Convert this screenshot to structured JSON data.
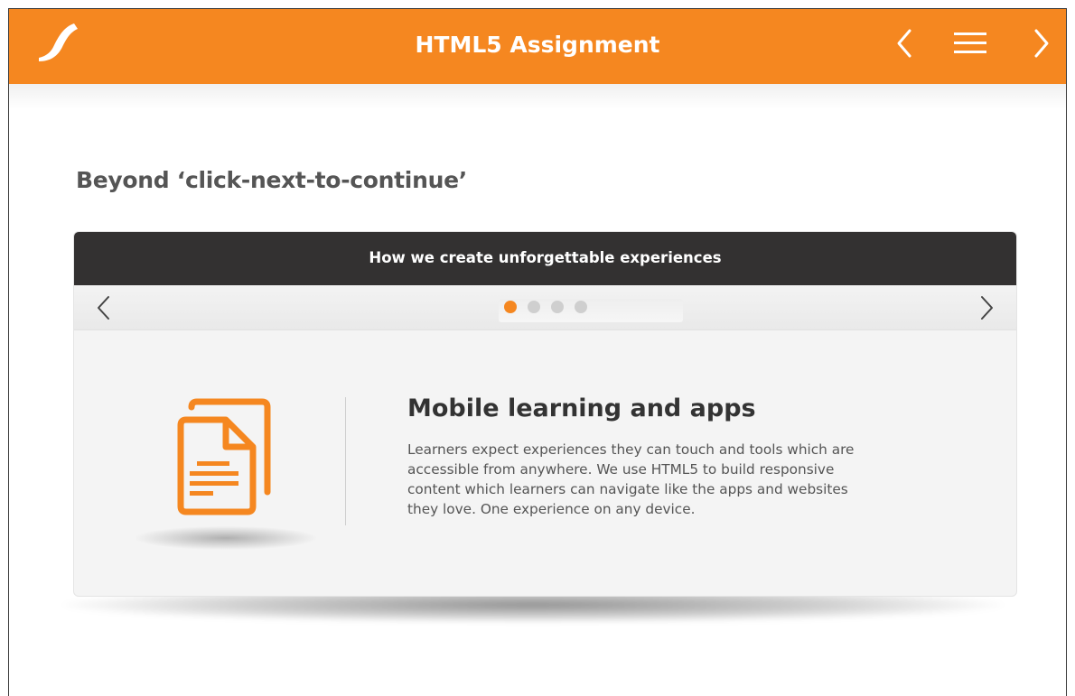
{
  "header": {
    "title": "HTML5 Assignment",
    "logo_icon": "swoosh-logo-icon",
    "prev_icon": "chevron-left-icon",
    "menu_icon": "hamburger-menu-icon",
    "next_icon": "chevron-right-icon",
    "background": "#f58720"
  },
  "page": {
    "heading": "Beyond ‘click-next-to-continue’"
  },
  "carousel": {
    "title": "How we create unforgettable experiences",
    "prev_icon": "chevron-left-icon",
    "next_icon": "chevron-right-icon",
    "slide_count": 4,
    "active_slide": 1,
    "active_dot_color": "#f58720",
    "inactive_dot_color": "#cfcfcf",
    "slide": {
      "icon": "documents-icon",
      "icon_color": "#f58720",
      "title": "Mobile learning and apps",
      "body": "Learners expect experiences they can touch and tools which are accessible from anywhere. We use HTML5 to build responsive content which learners can navigate like the apps and websites they love. One experience on any device."
    }
  }
}
